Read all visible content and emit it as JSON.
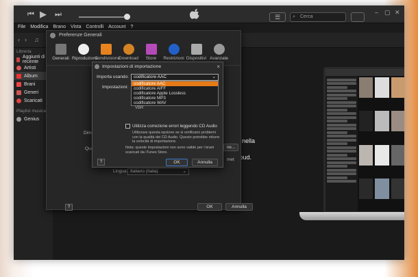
{
  "menubar": [
    "File",
    "Modifica",
    "Brano",
    "Vista",
    "Controlli",
    "Account",
    "?"
  ],
  "search": {
    "placeholder": "Cerca"
  },
  "sidebar": {
    "library_header": "Libreria",
    "items": [
      {
        "label": "Aggiunti di recente"
      },
      {
        "label": "Artisti"
      },
      {
        "label": "Album"
      },
      {
        "label": "Brani"
      },
      {
        "label": "Generi"
      },
      {
        "label": "Scaricati"
      }
    ],
    "playlist_header": "Playlist musica",
    "playlist_items": [
      {
        "label": "Genius"
      }
    ]
  },
  "promo": {
    "line1": "nti nella",
    "line2": "Cloud."
  },
  "pref": {
    "title": "Preferenze Generali",
    "tabs": [
      "Generali",
      "Riproduzione",
      "Condivisione",
      "Download",
      "Store",
      "Restrizioni",
      "Dispositivi",
      "Avanzate"
    ],
    "label_dime": "Dime",
    "label_qua": "Qua",
    "label_lingua": "Lingua:",
    "lingua_value": "Italiano (Italia)",
    "ne_btn": "ne...",
    "met": "met",
    "help": "?",
    "ok": "OK",
    "cancel": "Annulla"
  },
  "import": {
    "title": "Impostazioni di importazione",
    "close": "×",
    "import_label": "Importa usando:",
    "selected": "codificatore AAC",
    "settings_label": "Impostazioni:",
    "options": [
      "codificatore AAC",
      "codificatore AIFF",
      "codificatore Apple Lossless",
      "codificatore MP3",
      "codificatore WAV"
    ],
    "vbr": "VBR",
    "checkbox_label": "Utilizza correzione errori leggendo CD Audio",
    "checkbox_desc": "Utilizzare questa opzione se si verificano problemi con la qualità dei CD Audio. Questo potrebbe ridurre la velocità di importazione.",
    "note": "Nota: queste impostazioni non sono valide per i brani scaricati da iTunes Store.",
    "help": "?",
    "ok": "OK",
    "cancel": "Annulla"
  }
}
